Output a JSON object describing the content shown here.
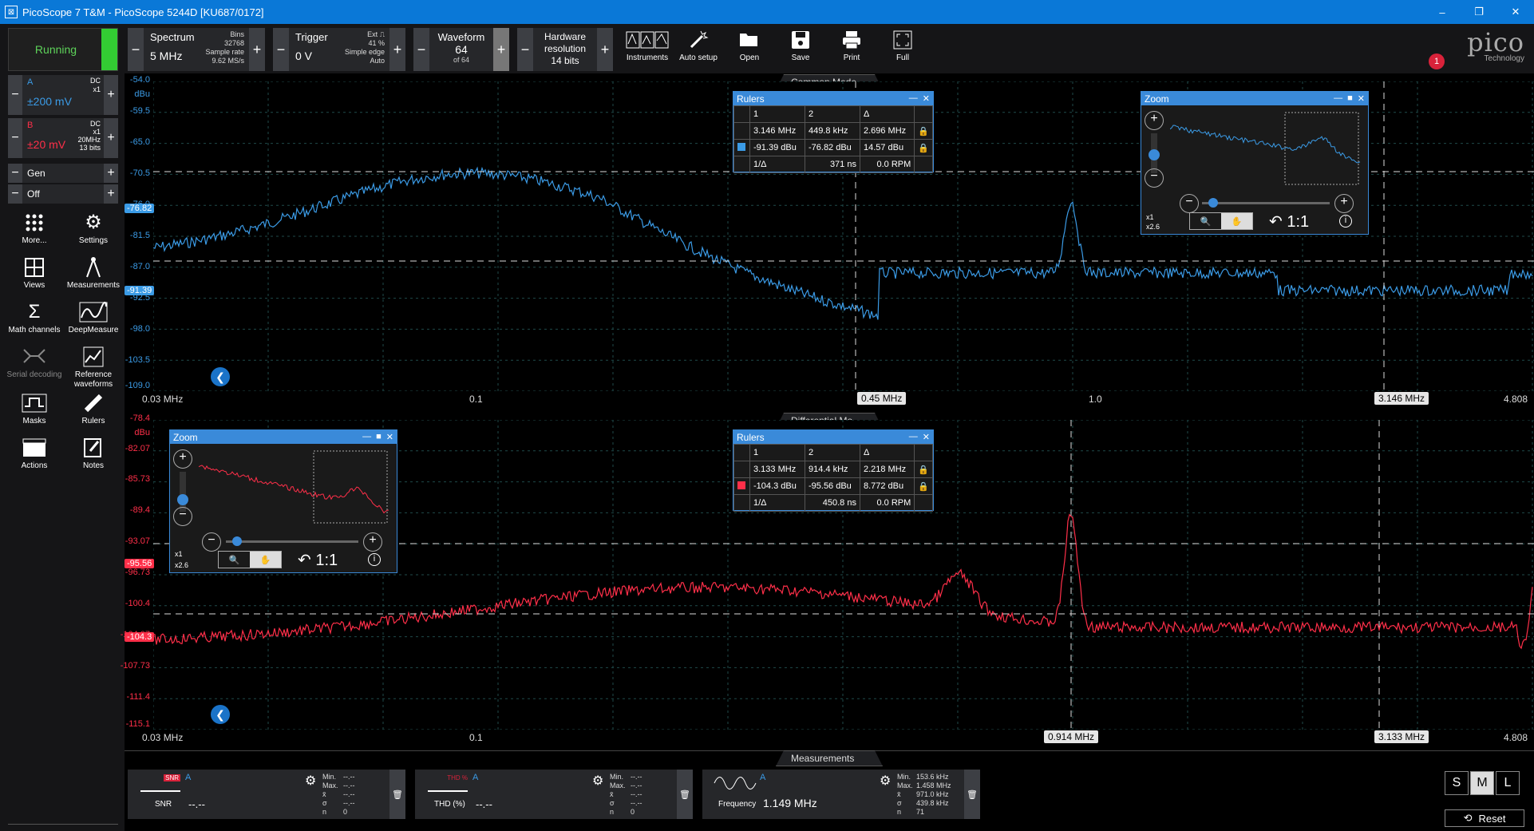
{
  "window": {
    "title": "PicoScope 7 T&M  - PicoScope 5244D [KU687/0172]",
    "controls": [
      "–",
      "❐",
      "✕"
    ]
  },
  "toolbar": {
    "run_state": "Running",
    "spectrum": {
      "label": "Spectrum",
      "value": "5 MHz",
      "bins_label": "Bins",
      "bins": "32768",
      "rate_label": "Sample rate",
      "rate": "9.62 MS/s"
    },
    "trigger": {
      "label": "Trigger",
      "value": "0 V",
      "ext": "Ext",
      "pct": "41 %",
      "mode": "Simple edge",
      "auto": "Auto"
    },
    "waveform": {
      "label": "Waveform",
      "value": "64",
      "of": "of 64"
    },
    "hardware": {
      "label": "Hardware",
      "label2": "resolution",
      "value": "14 bits"
    },
    "buttons": [
      {
        "label": "Instruments",
        "icon": "instruments-icon"
      },
      {
        "label": "Auto setup",
        "icon": "auto-setup-icon"
      },
      {
        "label": "Open",
        "icon": "folder-open-icon"
      },
      {
        "label": "Save",
        "icon": "save-icon"
      },
      {
        "label": "Print",
        "icon": "print-icon"
      },
      {
        "label": "Full",
        "icon": "fullscreen-icon"
      }
    ],
    "logo": {
      "brand": "pico",
      "sub": "Technology",
      "badge": "1"
    }
  },
  "channels": {
    "a": {
      "name": "A",
      "coupling": "DC",
      "probe": "x1",
      "range": "±200 mV",
      "color": "#3b9be6"
    },
    "b": {
      "name": "B",
      "coupling": "DC",
      "probe": "x1",
      "bw": "20MHz",
      "bits": "13 bits",
      "range": "±20 mV",
      "color": "#ff2f49"
    },
    "gen": "Gen",
    "off": "Off"
  },
  "sidebar": [
    {
      "label": "More...",
      "icon": "more-grid-icon"
    },
    {
      "label": "Settings",
      "icon": "gear-icon"
    },
    {
      "label": "Views",
      "icon": "views-icon"
    },
    {
      "label": "Measurements",
      "icon": "measurements-icon"
    },
    {
      "label": "Math channels",
      "icon": "sigma-icon"
    },
    {
      "label": "DeepMeasure",
      "icon": "deepmeasure-icon"
    },
    {
      "label": "Serial decoding",
      "icon": "serial-decoding-icon"
    },
    {
      "label": "Reference waveforms",
      "icon": "reference-waveforms-icon"
    },
    {
      "label": "Masks",
      "icon": "masks-icon"
    },
    {
      "label": "Rulers",
      "icon": "rulers-icon"
    },
    {
      "label": "Actions",
      "icon": "actions-icon"
    },
    {
      "label": "Notes",
      "icon": "notes-icon"
    }
  ],
  "view_top": {
    "tab": "Common Mode",
    "unit": "dBu",
    "y_ticks": [
      "-54.0",
      "-59.5",
      "-65.0",
      "-70.5",
      "-76.0",
      "-81.5",
      "-87.0",
      "-92.5",
      "-98.0",
      "-103.5",
      "-109.0"
    ],
    "x_ticks": [
      "0.03 MHz",
      "0.1",
      "1.0",
      "4.808"
    ],
    "ruler_x1": "0.45 MHz",
    "ruler_x2": "3.146 MHz",
    "ruler_y1": "-76.82",
    "ruler_y2": "-91.39",
    "rulers": {
      "title": "Rulers",
      "head": [
        "1",
        "2",
        "Δ"
      ],
      "freq": [
        "3.146 MHz",
        "449.8 kHz",
        "2.696 MHz"
      ],
      "level": [
        "-91.39 dBu",
        "-76.82 dBu",
        "14.57 dBu"
      ],
      "inv": [
        "1/Δ",
        "371 ns",
        "0.0 RPM"
      ]
    },
    "zoom": {
      "title": "Zoom",
      "x1": "x1",
      "x26": "x2.6",
      "ratio": "1:1"
    }
  },
  "view_bottom": {
    "tab": "Differential Mo...",
    "unit": "dBu",
    "y_ticks": [
      "-78.4",
      "-82.07",
      "-85.73",
      "-89.4",
      "-93.07",
      "-96.73",
      "-100.4",
      "-104.07",
      "-107.73",
      "-111.4",
      "-115.1"
    ],
    "x_ticks": [
      "0.03 MHz",
      "0.1",
      "4.808"
    ],
    "ruler_x1": "0.914 MHz",
    "ruler_x2": "3.133 MHz",
    "ruler_y1": "-95.56",
    "ruler_y2": "-104.3",
    "rulers": {
      "title": "Rulers",
      "head": [
        "1",
        "2",
        "Δ"
      ],
      "freq": [
        "3.133 MHz",
        "914.4 kHz",
        "2.218 MHz"
      ],
      "level": [
        "-104.3 dBu",
        "-95.56 dBu",
        "8.772 dBu"
      ],
      "inv": [
        "1/Δ",
        "450.8 ns",
        "0.0 RPM"
      ]
    },
    "zoom": {
      "title": "Zoom",
      "x1": "x1",
      "x26": "x2.6",
      "ratio": "1:1"
    }
  },
  "measurements": {
    "tab": "Measurements",
    "cards": [
      {
        "name": "SNR",
        "icon_text": "SNR",
        "ch": "A",
        "value": "--.--",
        "stats": [
          "Min.",
          "Max.",
          "x̄",
          "σ",
          "n"
        ],
        "vals": [
          "--.--",
          "--.--",
          "--.--",
          "--.--",
          "0"
        ]
      },
      {
        "name": "THD (%)",
        "icon_text": "THD %",
        "ch": "A",
        "value": "--.--",
        "stats": [
          "Min.",
          "Max.",
          "x̄",
          "σ",
          "n"
        ],
        "vals": [
          "--.--",
          "--.--",
          "--.--",
          "--.--",
          "0"
        ]
      },
      {
        "name": "Frequency",
        "icon_text": "",
        "ch": "A",
        "value": "1.149 MHz",
        "stats": [
          "Min.",
          "Max.",
          "x̄",
          "σ",
          "n"
        ],
        "vals": [
          "153.6 kHz",
          "1.458 MHz",
          "971.0 kHz",
          "439.8 kHz",
          "71"
        ]
      }
    ],
    "size_buttons": [
      "S",
      "M",
      "L"
    ],
    "reset": "Reset"
  }
}
